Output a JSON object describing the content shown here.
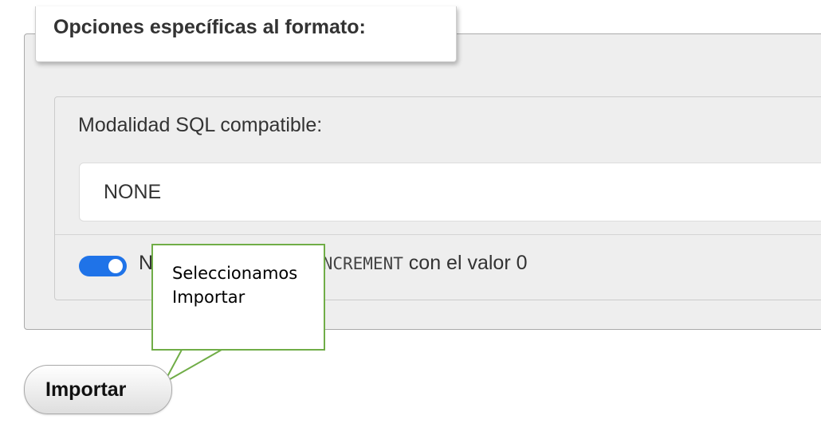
{
  "format_options": {
    "legend": "Opciones específicas al formato:",
    "sql_mode_label": "Modalidad SQL compatible:",
    "sql_mode_value": "NONE",
    "option_prefix": "N",
    "option_code": "INCREMENT",
    "option_suffix": " con el valor 0",
    "option_enabled": true,
    "toggle_color": "#1f73e8"
  },
  "callout": {
    "line1": "Seleccionamos",
    "line2": "Importar",
    "border_color": "#70ad47"
  },
  "actions": {
    "import_label": "Importar"
  }
}
